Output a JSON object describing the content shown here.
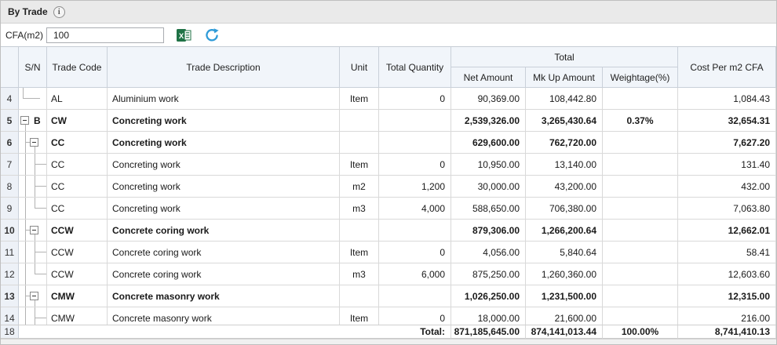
{
  "panel": {
    "title": "By Trade"
  },
  "toolbar": {
    "cfa_label": "CFA(m2)",
    "cfa_value": "100",
    "export_icon": "excel-export-icon",
    "refresh_icon": "refresh-icon",
    "excel_green": "#1f7246",
    "refresh_blue": "#2f9bd8"
  },
  "table": {
    "headers": {
      "sn": "S/N",
      "trade_code": "Trade Code",
      "trade_description": "Trade Description",
      "unit": "Unit",
      "total_quantity": "Total Quantity",
      "total_group": "Total",
      "net_amount": "Net Amount",
      "mkup_amount": "Mk Up Amount",
      "weightage": "Weightage(%)",
      "cost_per_m2": "Cost Per m2 CFA"
    },
    "rows": [
      {
        "num": "4",
        "sn_label": "",
        "code": "AL",
        "desc": "Aluminium work",
        "unit": "Item",
        "qty": "0",
        "net": "90,369.00",
        "mkup": "108,442.80",
        "weight": "",
        "cost": "1,084.43",
        "bold": false,
        "tree": {
          "t0": "none",
          "t1": "none",
          "conn": "elbow0",
          "exp": "none"
        }
      },
      {
        "num": "5",
        "sn_label": "B",
        "code": "CW",
        "desc": "Concreting work",
        "unit": "",
        "qty": "",
        "net": "2,539,326.00",
        "mkup": "3,265,430.64",
        "weight": "0.37%",
        "cost": "32,654.31",
        "bold": true,
        "tree": {
          "t0": "bottom",
          "t1": "none",
          "conn": "none",
          "exp": "x2"
        }
      },
      {
        "num": "6",
        "sn_label": "",
        "code": "CC",
        "desc": "Concreting work",
        "unit": "",
        "qty": "",
        "net": "629,600.00",
        "mkup": "762,720.00",
        "weight": "",
        "cost": "7,627.20",
        "bold": true,
        "tree": {
          "t0": "full",
          "t1": "bottom",
          "conn": "none",
          "exp": "x14"
        }
      },
      {
        "num": "7",
        "sn_label": "",
        "code": "CC",
        "desc": "Concreting work",
        "unit": "Item",
        "qty": "0",
        "net": "10,950.00",
        "mkup": "13,140.00",
        "weight": "",
        "cost": "131.40",
        "bold": false,
        "tree": {
          "t0": "full",
          "t1": "none",
          "conn": "tee1",
          "exp": "none"
        }
      },
      {
        "num": "8",
        "sn_label": "",
        "code": "CC",
        "desc": "Concreting work",
        "unit": "m2",
        "qty": "1,200",
        "net": "30,000.00",
        "mkup": "43,200.00",
        "weight": "",
        "cost": "432.00",
        "bold": false,
        "tree": {
          "t0": "full",
          "t1": "none",
          "conn": "tee1",
          "exp": "none"
        }
      },
      {
        "num": "9",
        "sn_label": "",
        "code": "CC",
        "desc": "Concreting work",
        "unit": "m3",
        "qty": "4,000",
        "net": "588,650.00",
        "mkup": "706,380.00",
        "weight": "",
        "cost": "7,063.80",
        "bold": false,
        "tree": {
          "t0": "full",
          "t1": "none",
          "conn": "elbow1",
          "exp": "none"
        }
      },
      {
        "num": "10",
        "sn_label": "",
        "code": "CCW",
        "desc": "Concrete coring work",
        "unit": "",
        "qty": "",
        "net": "879,306.00",
        "mkup": "1,266,200.64",
        "weight": "",
        "cost": "12,662.01",
        "bold": true,
        "tree": {
          "t0": "full",
          "t1": "bottom",
          "conn": "none",
          "exp": "x14"
        }
      },
      {
        "num": "11",
        "sn_label": "",
        "code": "CCW",
        "desc": "Concrete coring work",
        "unit": "Item",
        "qty": "0",
        "net": "4,056.00",
        "mkup": "5,840.64",
        "weight": "",
        "cost": "58.41",
        "bold": false,
        "tree": {
          "t0": "full",
          "t1": "none",
          "conn": "tee1",
          "exp": "none"
        }
      },
      {
        "num": "12",
        "sn_label": "",
        "code": "CCW",
        "desc": "Concrete coring work",
        "unit": "m3",
        "qty": "6,000",
        "net": "875,250.00",
        "mkup": "1,260,360.00",
        "weight": "",
        "cost": "12,603.60",
        "bold": false,
        "tree": {
          "t0": "full",
          "t1": "none",
          "conn": "elbow1",
          "exp": "none"
        }
      },
      {
        "num": "13",
        "sn_label": "",
        "code": "CMW",
        "desc": "Concrete masonry work",
        "unit": "",
        "qty": "",
        "net": "1,026,250.00",
        "mkup": "1,231,500.00",
        "weight": "",
        "cost": "12,315.00",
        "bold": true,
        "tree": {
          "t0": "full",
          "t1": "bottom",
          "conn": "none",
          "exp": "x14"
        }
      },
      {
        "num": "14",
        "sn_label": "",
        "code": "CMW",
        "desc": "Concrete masonry work",
        "unit": "Item",
        "qty": "0",
        "net": "18,000.00",
        "mkup": "21,600.00",
        "weight": "",
        "cost": "216.00",
        "bold": false,
        "tree": {
          "t0": "full",
          "t1": "none",
          "conn": "tee1",
          "exp": "none"
        }
      }
    ],
    "total_row": {
      "num": "18",
      "label": "Total:",
      "net": "871,185,645.00",
      "mkup": "874,141,013.44",
      "weight": "100.00%",
      "cost": "8,741,410.13"
    }
  }
}
